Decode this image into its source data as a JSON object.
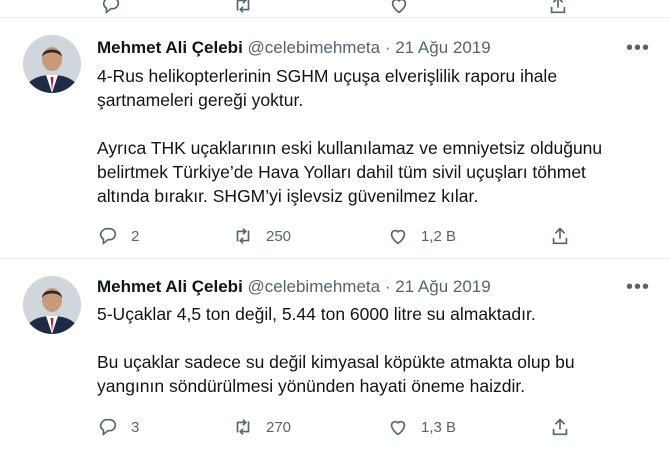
{
  "colors": {
    "text": "#0f1419",
    "secondary": "#536471",
    "divider": "#e6ecf0"
  },
  "top_icons": [
    "reply-icon",
    "retweet-icon",
    "like-icon",
    "share-icon"
  ],
  "tweets": [
    {
      "name": "Mehmet Ali Çelebi",
      "handle": "@celebimehmeta",
      "separator": "·",
      "date": "21 Ağu 2019",
      "more": "•••",
      "lines": [
        "4-Rus helikopterlerinin SGHM uçuşa elverişlilik raporu ihale",
        "şartnameleri gereği yoktur.",
        "Ayrıca THK uçaklarının eski kullanılamaz ve emniyetsiz olduğunu",
        "belirtmek Türkiye’de Hava Yolları dahil tüm sivil uçuşları töhmet",
        "altında bırakır. SHGM’yi işlevsiz güvenilmez kılar."
      ],
      "replies": "2",
      "retweets": "250",
      "likes": "1,2 B"
    },
    {
      "name": "Mehmet Ali Çelebi",
      "handle": "@celebimehmeta",
      "separator": "·",
      "date": "21 Ağu 2019",
      "more": "•••",
      "lines": [
        "5-Uçaklar 4,5 ton değil, 5.44 ton 6000 litre su almaktadır.",
        "Bu uçaklar sadece su değil kimyasal köpükte atmakta olup bu",
        "yangının söndürülmesi yönünden hayati öneme haizdir."
      ],
      "replies": "3",
      "retweets": "270",
      "likes": "1,3 B"
    }
  ]
}
